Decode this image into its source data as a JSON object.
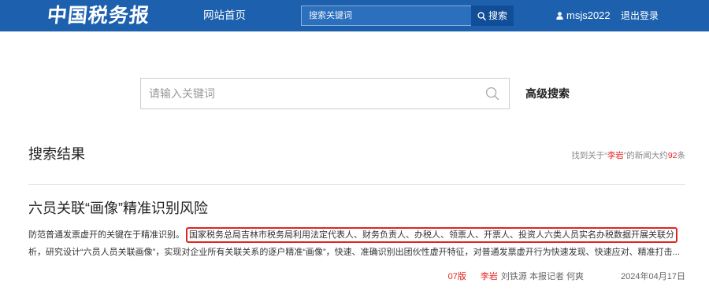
{
  "header": {
    "logo_text": "中国税务报",
    "nav_home": "网站首页",
    "search_placeholder": "搜索关键词",
    "search_value": "",
    "search_button": "搜索",
    "username": "msjs2022",
    "logout": "退出登录"
  },
  "search": {
    "placeholder": "请输入关键词",
    "value": "",
    "advanced_label": "高级搜索"
  },
  "results": {
    "heading": "搜索结果",
    "summary": {
      "prefix": "找到关于“",
      "keyword": "李岩",
      "middle": "”的新闻大约",
      "count": 92,
      "suffix": "条"
    },
    "items": [
      {
        "title": "六员关联“画像”精准识别风险",
        "snippet_lead": "防范普通发票虚开的关键在于精准识别。",
        "snippet_highlighted": "国家税务总局吉林市税务局利用法定代表人、财务负责人、办税人、领票人、开票人、投资人六类人员实名办税数据开展关联分",
        "snippet_rest": "析，研究设计“六员人员关联画像”，实现对企业所有关联关系的逐户精准“画像”，快速、准确识别出团伙性虚开特征，对普通发票虚开行为快速发现、快速应对、精准打击...",
        "edition": "07版",
        "keyword_author": "李岩",
        "authors": "刘铁源 本报记者 何爽",
        "date": "2024年04月17日"
      }
    ]
  },
  "icons": {
    "header_search": "search-icon",
    "user": "user-icon",
    "main_search": "search-icon"
  },
  "colors": {
    "header_bg": "#1c60ae",
    "search_button_bg": "#114e97",
    "accent_red": "#e3231f",
    "text_dark": "#222222",
    "text_muted": "#888888"
  }
}
